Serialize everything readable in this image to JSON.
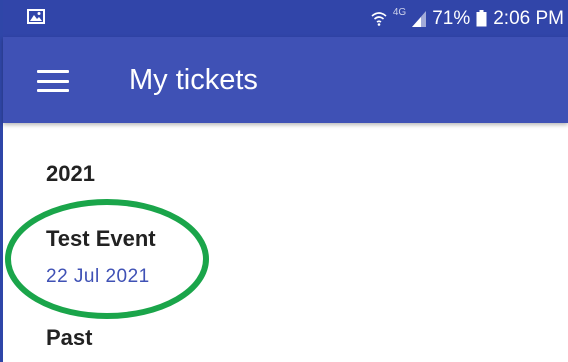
{
  "status_bar": {
    "network": "4G",
    "battery": "71%",
    "time": "2:06 PM",
    "icons": [
      "image-icon",
      "wifi-icon",
      "signal-icon",
      "battery-icon"
    ]
  },
  "app_bar": {
    "title": "My tickets",
    "menu_icon": "hamburger-menu-icon"
  },
  "tickets": {
    "year_section": "2021",
    "items": [
      {
        "name": "Test Event",
        "date": "22 Jul 2021"
      }
    ],
    "past_section": "Past"
  },
  "colors": {
    "primary": "#3f51b5",
    "status_bar": "#3145a9",
    "highlight": "#1aa54a",
    "text": "#222222"
  }
}
